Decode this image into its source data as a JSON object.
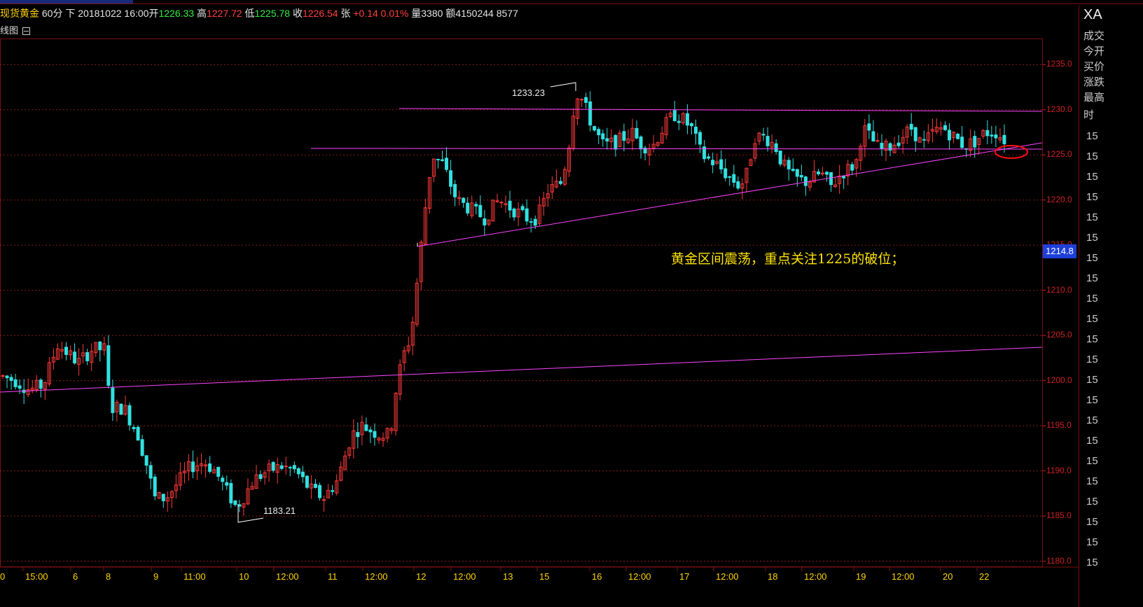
{
  "header": {
    "symbol": "现货黄金",
    "period": "60分",
    "direction": "下",
    "datetime": "20181022 16:00",
    "open_label": "开",
    "open": "1226.33",
    "high_label": "高",
    "high": "1227.72",
    "low_label": "低",
    "low": "1225.78",
    "close_label": "收",
    "close": "1226.54",
    "change_label": "张",
    "change": "+0.14 0.01%",
    "volume_label": "量",
    "volume": "3380",
    "amount_label": "额",
    "amount": "4150244 8577"
  },
  "subbar": {
    "label": "线图"
  },
  "right_panel": {
    "title": "XA",
    "labels": [
      "成交",
      "今开",
      "买价",
      "涨跌",
      "最高",
      "时"
    ],
    "numbers": [
      "15",
      "15",
      "15",
      "15",
      "15",
      "15",
      "15",
      "15",
      "15",
      "15",
      "15",
      "15",
      "15",
      "15",
      "15",
      "15",
      "15",
      "15",
      "15",
      "15",
      "15",
      "15"
    ]
  },
  "price_tag": "1214.8",
  "annotation": "黄金区间震荡，重点关注1225的破位；",
  "peaks": {
    "high_label": "1233.23",
    "low_label": "1183.21"
  },
  "colors": {
    "up": "#ff3a3a",
    "down": "#33e0e0",
    "grid": "#8a1a1a",
    "trend": "#ff44ff",
    "annotation": "#ffe400"
  },
  "chart_data": {
    "type": "candlestick",
    "y_ticks": [
      "1235.0",
      "1230.0",
      "1225.0",
      "1220.0",
      "1215.0",
      "1210.0",
      "1205.0",
      "1200.0",
      "1195.0",
      "1190.0",
      "1185.0",
      "1180.0"
    ],
    "ylim": [
      1179.5,
      1237.5
    ],
    "x_labels": [
      "0",
      "15:00",
      "6",
      "8",
      "9",
      "11:00",
      "10",
      "12:00",
      "11",
      "12:00",
      "12",
      "12:00",
      "13",
      "15",
      "16",
      "12:00",
      "17",
      "12:00",
      "18",
      "12:00",
      "19",
      "12:00",
      "20",
      "22"
    ],
    "highlight_marker": "red-ellipse",
    "trend_lines": "horizontal resistance near 1230 and 1225, rising support lines",
    "candle_count": 238
  }
}
